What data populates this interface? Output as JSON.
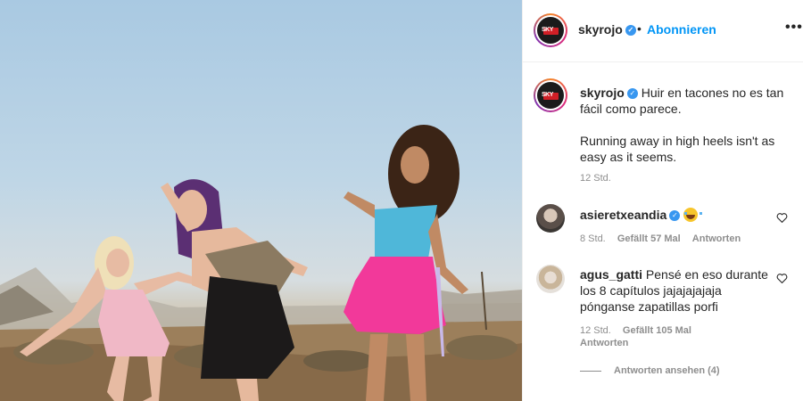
{
  "post": {
    "username": "skyrojo",
    "follow_label": "Abonnieren",
    "more_label": "•••",
    "avatar_logo_text": "SKY"
  },
  "caption": {
    "username": "skyrojo",
    "text_es": "Huir en tacones no es tan fácil como parece.",
    "text_en": "Running away in high heels isn't as easy as it seems.",
    "time": "12 Std."
  },
  "comments": [
    {
      "username": "asieretxeandia",
      "verified": true,
      "text": "",
      "emoji": "crying-laughing",
      "time": "8 Std.",
      "likes": "Gefällt 57 Mal",
      "reply_label": "Antworten"
    },
    {
      "username": "agus_gatti",
      "verified": false,
      "text": "Pensé en eso durante los 8 capítulos jajajajajaja pónganse zapatillas porfi",
      "time": "12 Std.",
      "likes": "Gefällt 105 Mal",
      "reply_label": "Antworten",
      "view_replies": "Antworten ansehen (4)"
    }
  ],
  "colors": {
    "accent": "#0095f6",
    "verified": "#3897f0",
    "muted": "#8e8e8e",
    "text": "#262626"
  }
}
